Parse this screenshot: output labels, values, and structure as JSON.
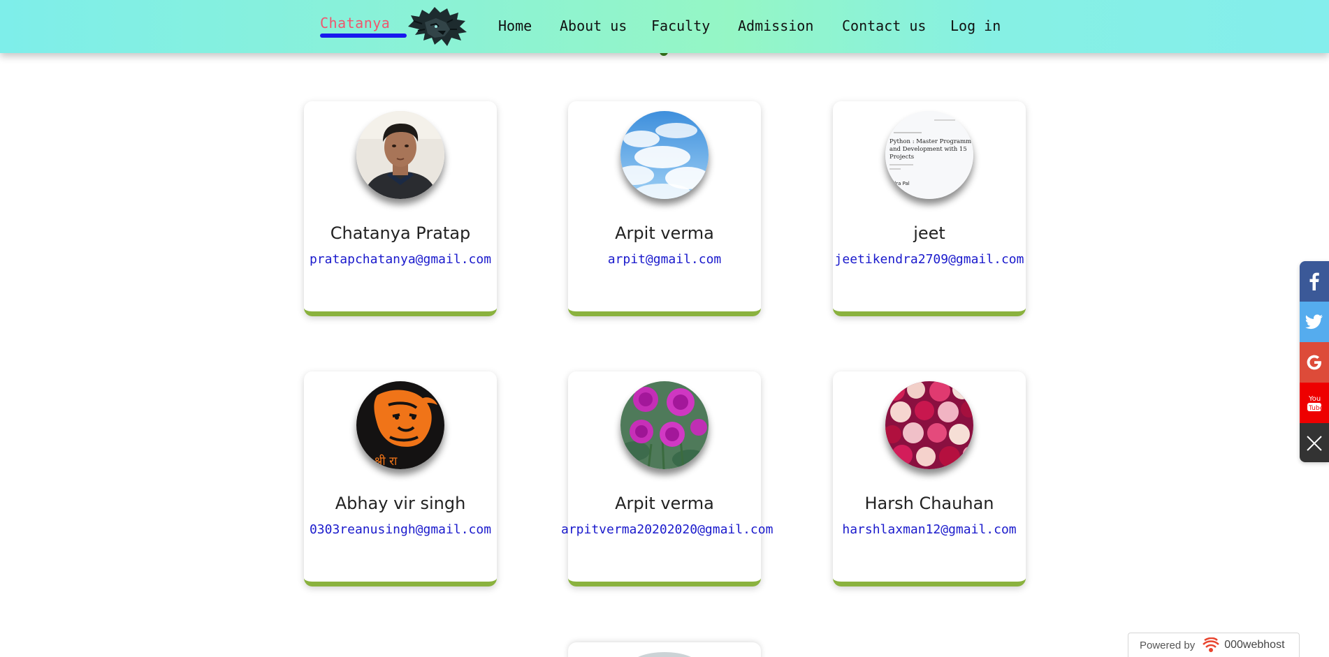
{
  "nav": {
    "brand": "Chatanya",
    "links": [
      "Home",
      "About us",
      "Faculty",
      "Admission",
      "Contact us",
      "Log in"
    ]
  },
  "cards": [
    {
      "name": "Chatanya Pratap",
      "email": "pratapchatanya@gmail.com",
      "avatar": "person-portrait"
    },
    {
      "name": "Arpit verma",
      "email": "arpit@gmail.com",
      "avatar": "blue-sky-clouds"
    },
    {
      "name": "jeet",
      "email": "jeetikendra2709@gmail.com",
      "avatar": "book-cover"
    },
    {
      "name": "Abhay vir singh",
      "email": "0303reanusingh@gmail.com",
      "avatar": "orange-hanuman-art"
    },
    {
      "name": "Arpit verma",
      "email": "arpitverma20202020@gmail.com",
      "avatar": "pink-roses"
    },
    {
      "name": "Harsh Chauhan",
      "email": "harshlaxman12@gmail.com",
      "avatar": "rose-bouquet"
    }
  ],
  "book_cover": {
    "title_line1": "Python : Master Programming",
    "title_line2": "and Development with 15",
    "title_line3": "Projects",
    "author": "endra Pal"
  },
  "hanuman_caption": "य श्री रा",
  "social": [
    {
      "name": "facebook",
      "color": "#3b5998"
    },
    {
      "name": "twitter",
      "color": "#55acee"
    },
    {
      "name": "google",
      "color": "#dd4b39"
    },
    {
      "name": "youtube",
      "color": "#ee0000"
    },
    {
      "name": "close",
      "color": "#333333"
    }
  ],
  "powered": {
    "label": "Powered by",
    "brand": "000webhost"
  },
  "colors": {
    "accent_green": "#8ab23e",
    "email_blue": "#1a1acc",
    "brand_pink": "#f0566e"
  }
}
